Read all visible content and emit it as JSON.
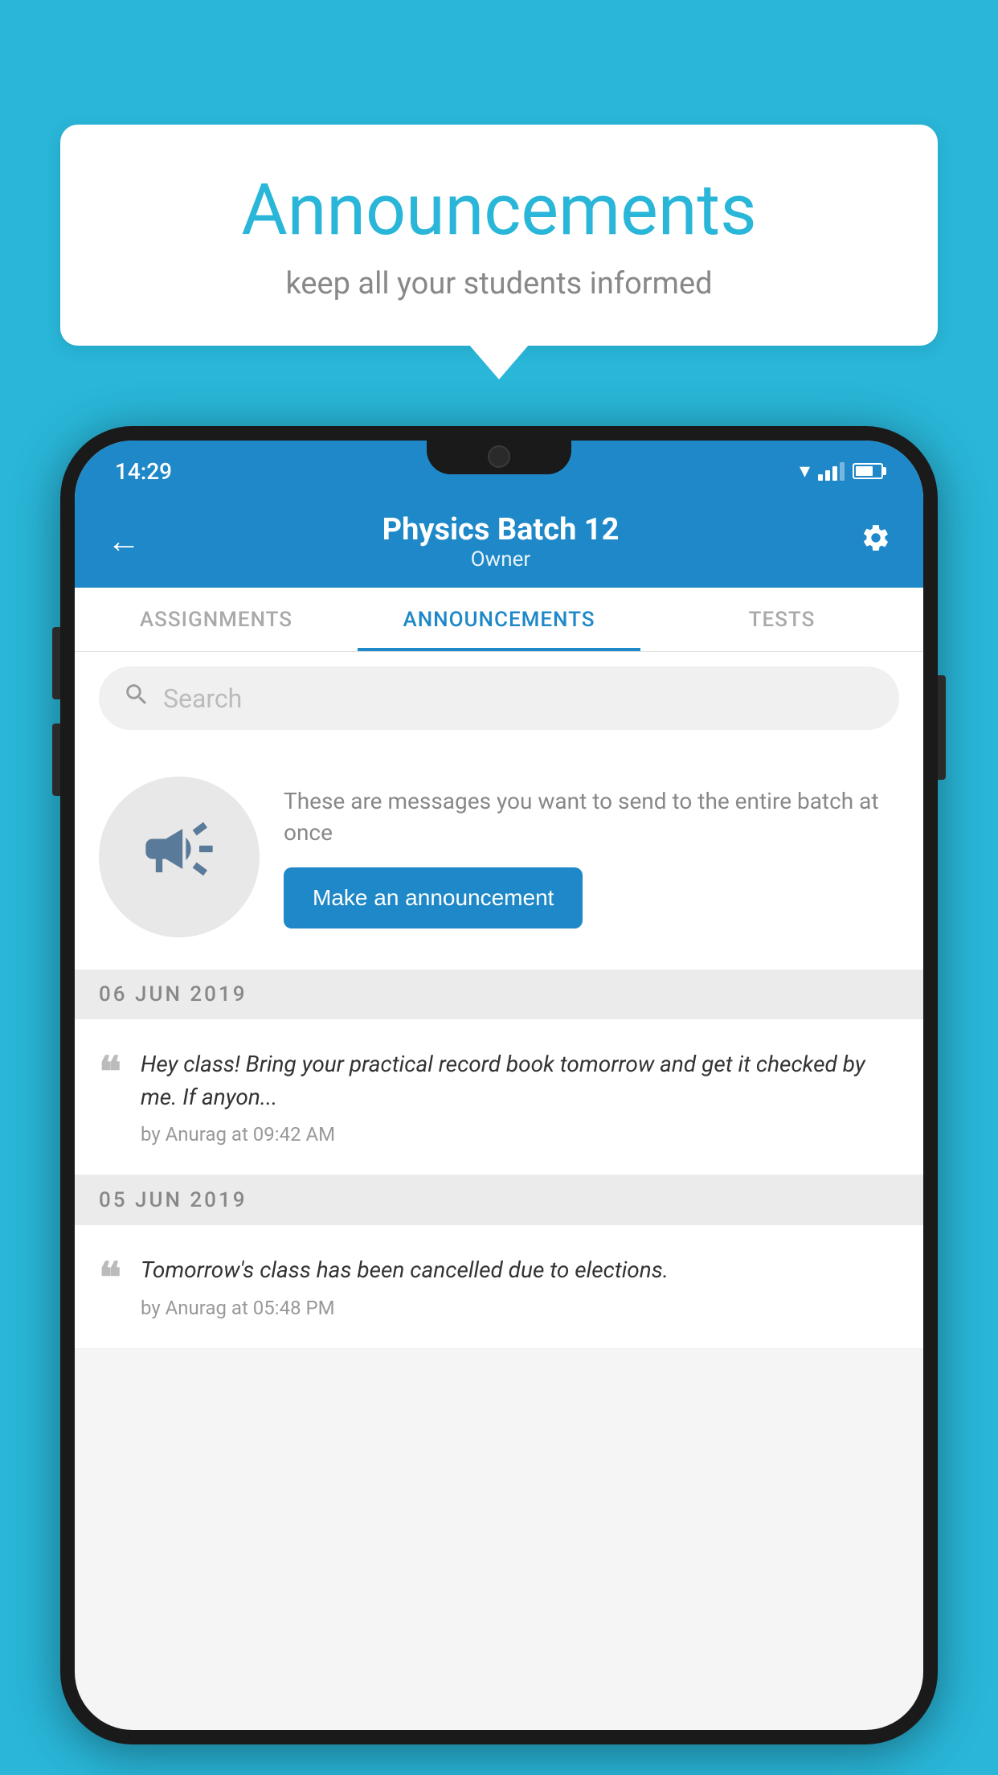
{
  "background_color": "#29b6d8",
  "speech_bubble": {
    "title": "Announcements",
    "subtitle": "keep all your students informed"
  },
  "phone": {
    "status_bar": {
      "time": "14:29"
    },
    "app_bar": {
      "title": "Physics Batch 12",
      "subtitle": "Owner",
      "back_label": "←",
      "settings_label": "⚙"
    },
    "tabs": [
      {
        "label": "ASSIGNMENTS",
        "active": false
      },
      {
        "label": "ANNOUNCEMENTS",
        "active": true
      },
      {
        "label": "TESTS",
        "active": false
      }
    ],
    "search": {
      "placeholder": "Search"
    },
    "promo": {
      "description": "These are messages you want to send to the entire batch at once",
      "button_label": "Make an announcement"
    },
    "announcements": [
      {
        "date": "06  JUN  2019",
        "text": "Hey class! Bring your practical record book tomorrow and get it checked by me. If anyon...",
        "meta": "by Anurag at 09:42 AM"
      },
      {
        "date": "05  JUN  2019",
        "text": "Tomorrow's class has been cancelled due to elections.",
        "meta": "by Anurag at 05:48 PM"
      }
    ]
  }
}
